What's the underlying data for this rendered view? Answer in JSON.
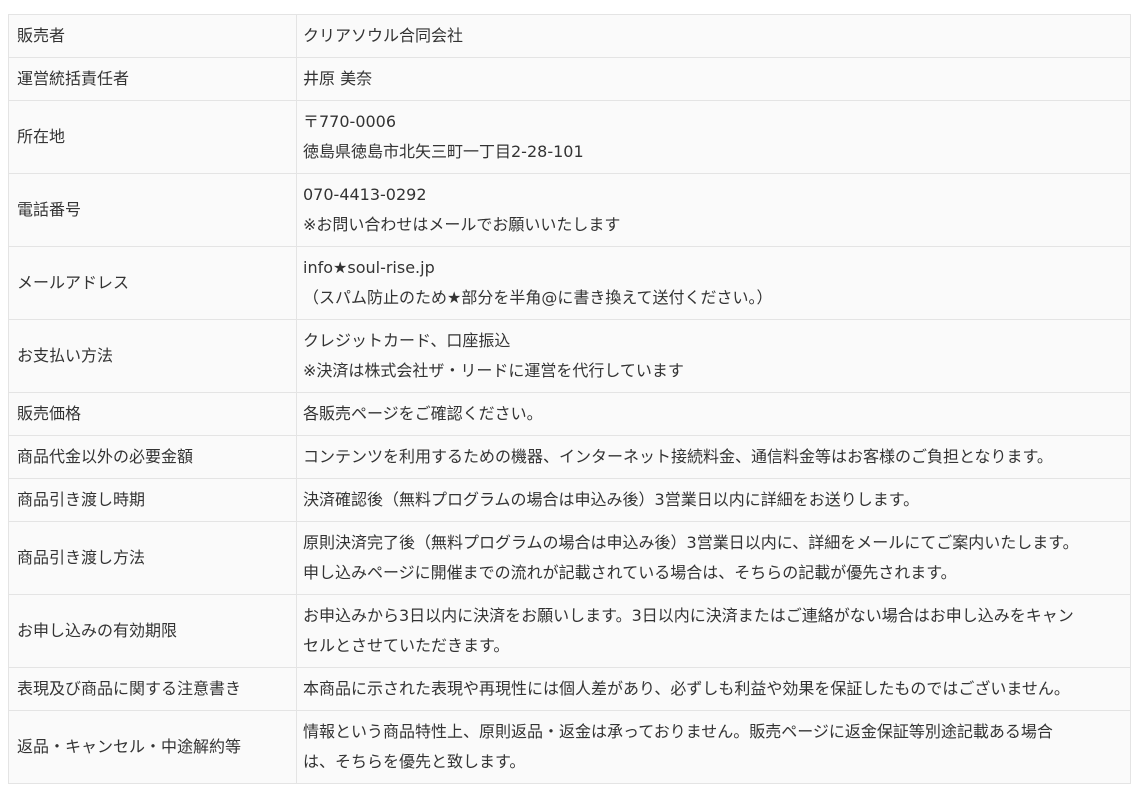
{
  "rows": [
    {
      "label": "販売者",
      "lines": [
        "クリアソウル合同会社"
      ]
    },
    {
      "label": "運営統括責任者",
      "lines": [
        "井原 美奈"
      ]
    },
    {
      "label": "所在地",
      "lines": [
        "〒770-0006",
        "徳島県徳島市北矢三町一丁目2-28-101"
      ]
    },
    {
      "label": "電話番号",
      "lines": [
        "070-4413-0292",
        "※お問い合わせはメールでお願いいたします"
      ]
    },
    {
      "label": "メールアドレス",
      "lines": [
        "info★soul-rise.jp",
        "（スパム防止のため★部分を半角@に書き換えて送付ください。）"
      ]
    },
    {
      "label": "お支払い方法",
      "lines": [
        "クレジットカード、口座振込",
        "※決済は株式会社ザ・リードに運営を代行しています"
      ]
    },
    {
      "label": "販売価格",
      "lines": [
        "各販売ページをご確認ください。"
      ]
    },
    {
      "label": "商品代金以外の必要金額",
      "lines": [
        "コンテンツを利用するための機器、インターネット接続料金、通信料金等はお客様のご負担となります。"
      ]
    },
    {
      "label": "商品引き渡し時期",
      "lines": [
        "決済確認後（無料プログラムの場合は申込み後）3営業日以内に詳細をお送りします。"
      ]
    },
    {
      "label": "商品引き渡し方法",
      "lines": [
        "原則決済完了後（無料プログラムの場合は申込み後）3営業日以内に、詳細をメールにてご案内いたします。",
        "申し込みページに開催までの流れが記載されている場合は、そちらの記載が優先されます。"
      ]
    },
    {
      "label": "お申し込みの有効期限",
      "lines": [
        "お申込みから3日以内に決済をお願いします。3日以内に決済またはご連絡がない場合はお申し込みをキャン",
        "セルとさせていただきます。"
      ]
    },
    {
      "label": "表現及び商品に関する注意書き",
      "lines": [
        "本商品に示された表現や再現性には個人差があり、必ずしも利益や効果を保証したものではございません。"
      ]
    },
    {
      "label": "返品・キャンセル・中途解約等",
      "lines": [
        "情報という商品特性上、原則返品・返金は承っておりません。販売ページに返金保証等別途記載ある場合",
        "は、そちらを優先と致します。"
      ]
    }
  ]
}
